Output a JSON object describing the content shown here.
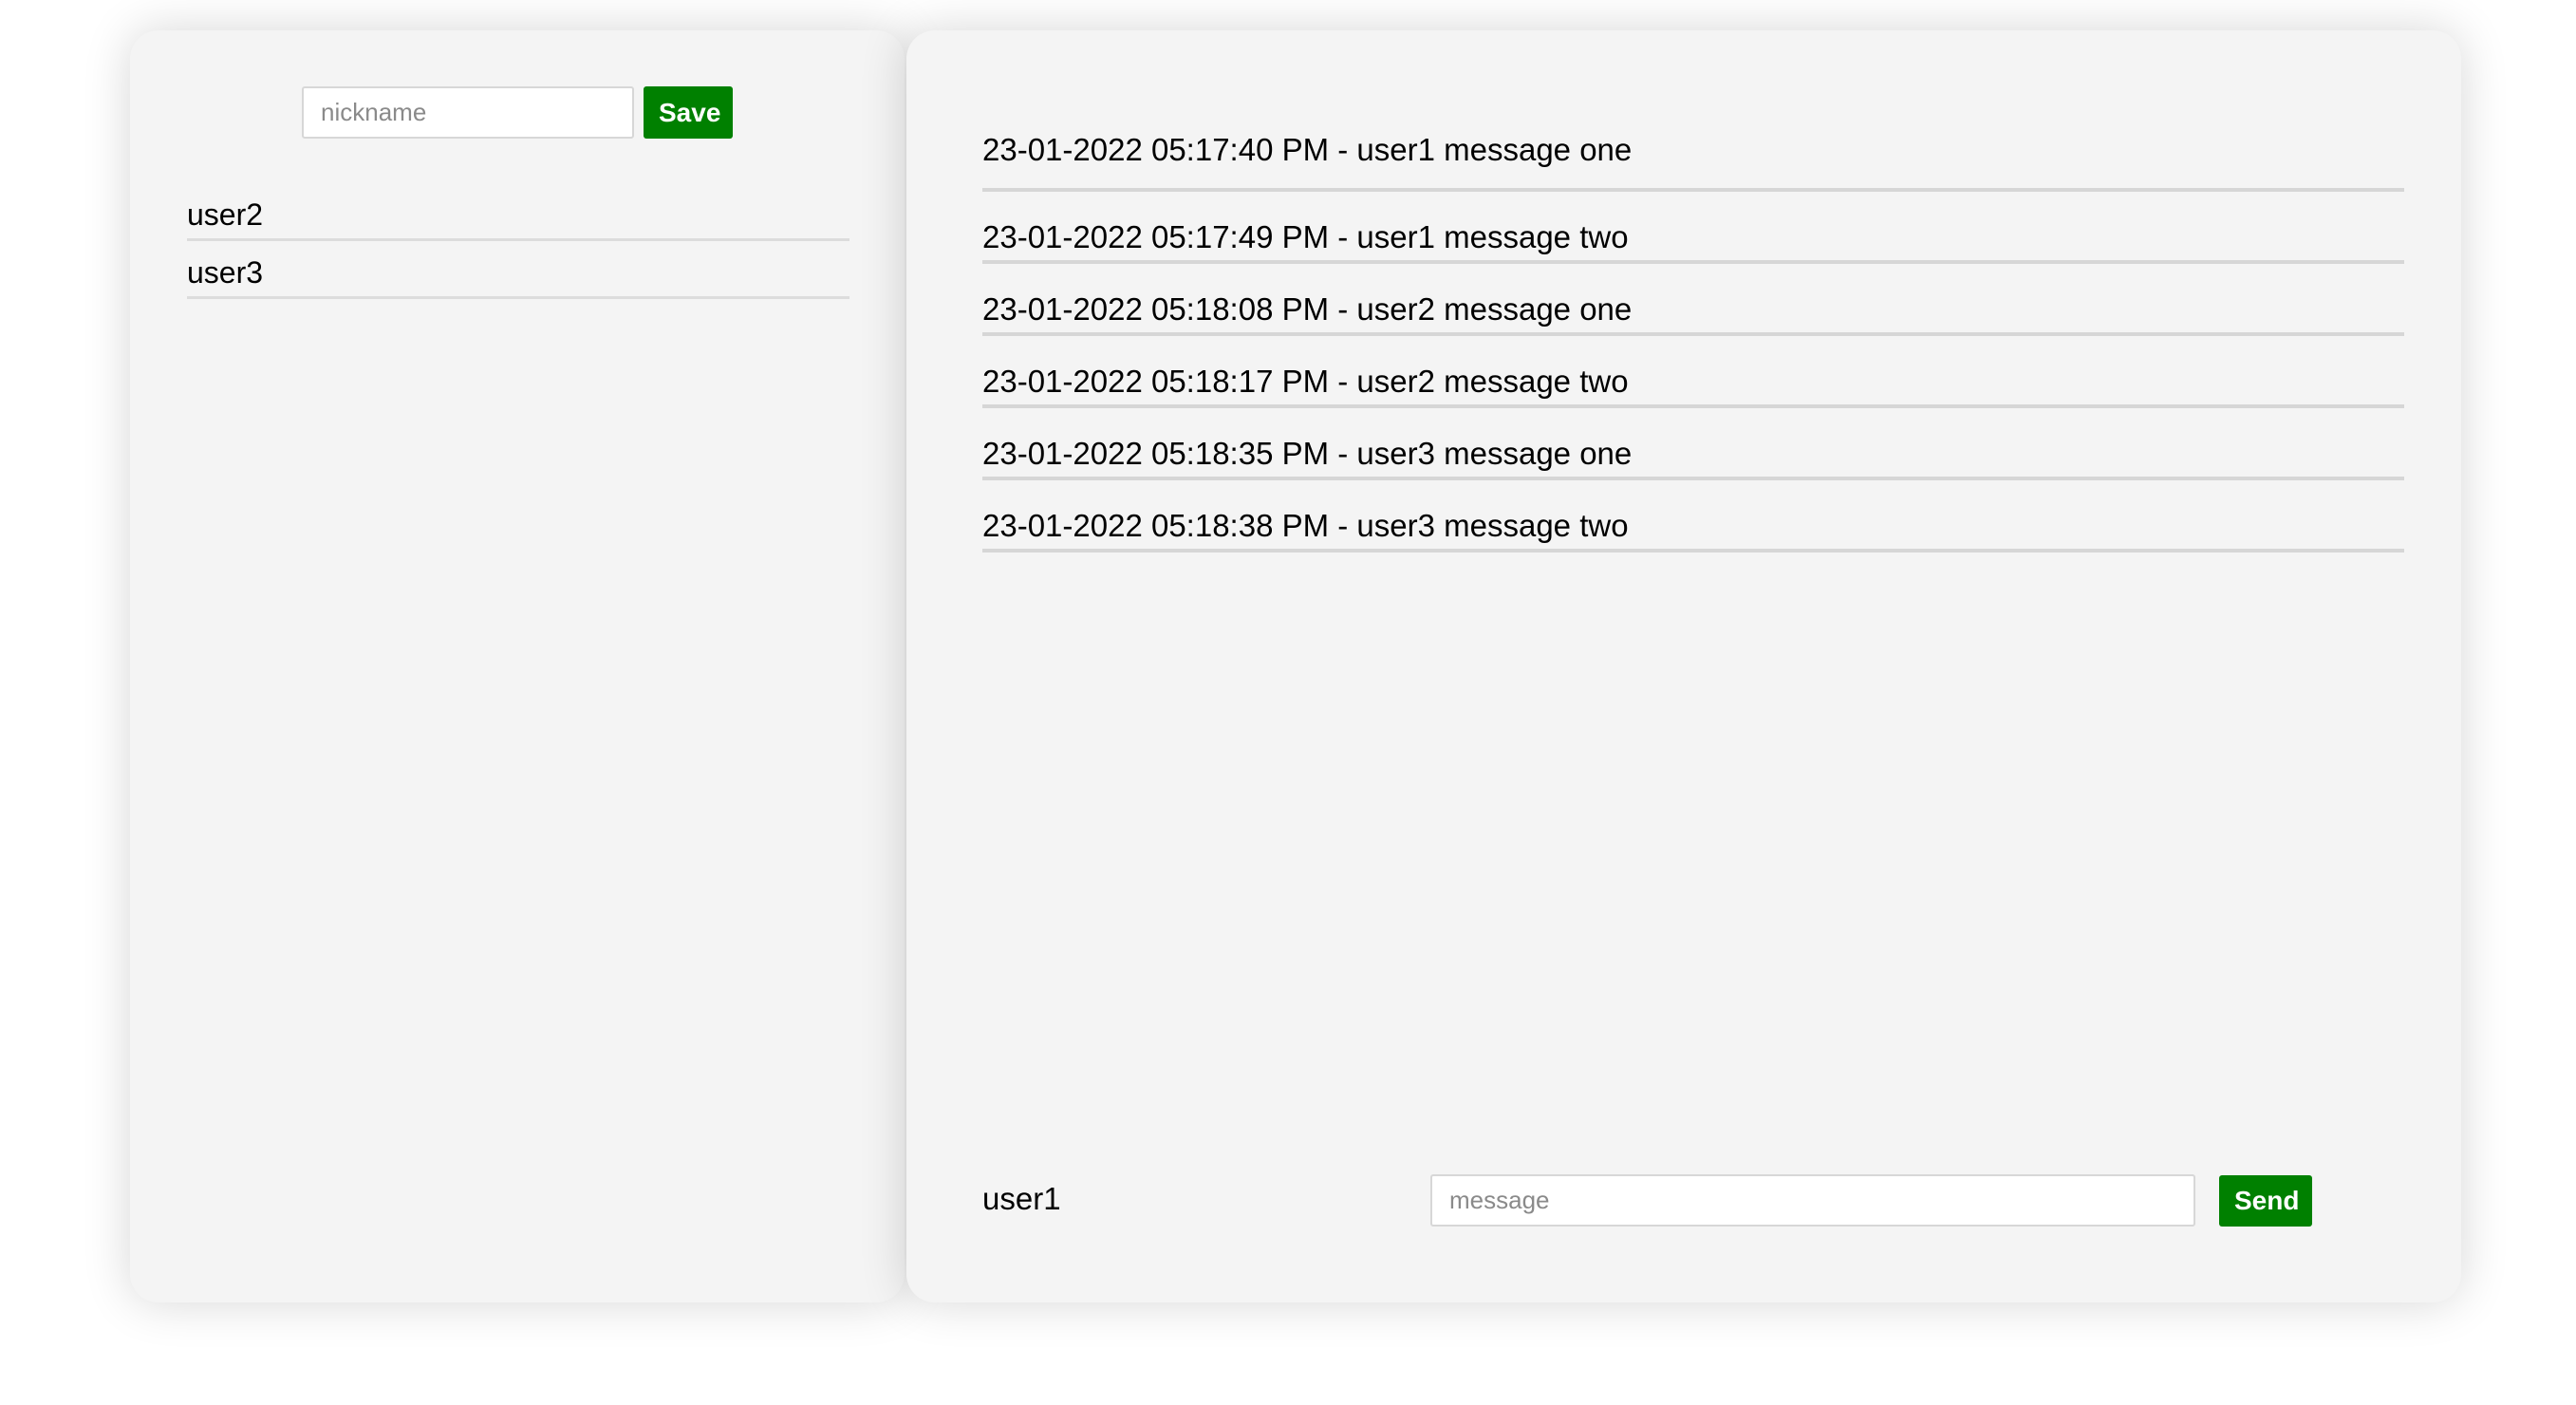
{
  "sidebar": {
    "nickname_placeholder": "nickname",
    "nickname_value": "",
    "save_label": "Save",
    "users": [
      "user2",
      "user3"
    ]
  },
  "chat": {
    "messages": [
      "23-01-2022 05:17:40 PM - user1 message one",
      "23-01-2022 05:17:49 PM - user1 message two",
      "23-01-2022 05:18:08 PM - user2 message one",
      "23-01-2022 05:18:17 PM - user2 message two",
      "23-01-2022 05:18:35 PM - user3 message one",
      "23-01-2022 05:18:38 PM - user3 message two"
    ],
    "current_user": "user1",
    "message_placeholder": "message",
    "message_value": "",
    "send_label": "Send"
  },
  "colors": {
    "panel_background": "#f4f4f4",
    "button_green": "#008000",
    "divider": "#d6d6d6"
  }
}
